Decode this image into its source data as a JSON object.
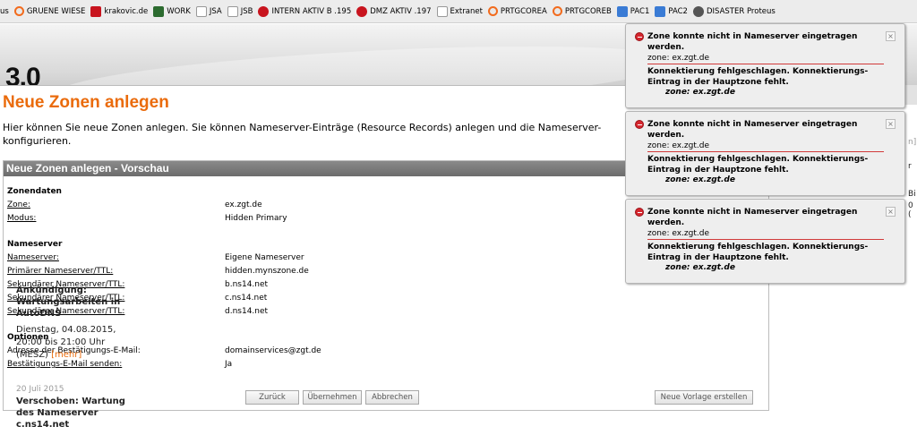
{
  "bookmarks": [
    {
      "label": "us",
      "icon": "page-icon"
    },
    {
      "label": "GRUENE WIESE",
      "icon": "prtg-icon"
    },
    {
      "label": "krakovic.de",
      "icon": "krakovic-icon"
    },
    {
      "label": "WORK",
      "icon": "work-icon"
    },
    {
      "label": "JSA",
      "icon": "blank-page-icon"
    },
    {
      "label": "JSB",
      "icon": "blank-page-icon"
    },
    {
      "label": "INTERN AKTIV B .195",
      "icon": "intern-icon"
    },
    {
      "label": "DMZ AKTIV .197",
      "icon": "dmz-icon"
    },
    {
      "label": "Extranet",
      "icon": "extranet-icon"
    },
    {
      "label": "PRTGCOREA",
      "icon": "prtg-icon"
    },
    {
      "label": "PRTGCOREB",
      "icon": "prtg-icon"
    },
    {
      "label": "PAC1",
      "icon": "pac-icon"
    },
    {
      "label": "PAC2",
      "icon": "pac-icon"
    },
    {
      "label": "DISASTER Proteus",
      "icon": "disaster-icon"
    }
  ],
  "header": {
    "logo": "3.0"
  },
  "page": {
    "title": "Neue Zonen anlegen",
    "intro": "Hier können Sie neue Zonen anlegen. Sie können Nameserver-Einträge (Resource Records) anlegen und die Nameserver-",
    "intro2": "konfigurieren."
  },
  "panel": {
    "title": "Neue Zonen anlegen - Vorschau",
    "zonendaten": {
      "heading": "Zonendaten",
      "zone_label": "Zone:",
      "zone_value": "ex.zgt.de",
      "modus_label": "Modus:",
      "modus_value": "Hidden Primary"
    },
    "nameserver": {
      "heading": "Nameserver",
      "ns_label": "Nameserver:",
      "ns_value": "Eigene Nameserver",
      "primary_label": "Primärer Nameserver/TTL:",
      "primary_value": "hidden.mynszone.de",
      "sec1_label": "Sekundärer Nameserver/TTL:",
      "sec1_value": "b.ns14.net",
      "sec2_label": "Sekundärer Nameserver/TTL:",
      "sec2_value": "c.ns14.net",
      "sec3_label": "Sekundärer Nameserver/TTL:",
      "sec3_value": "d.ns14.net"
    },
    "optionen": {
      "heading": "Optionen",
      "email_label": "Adresse der Bestätigungs-E-Mail:",
      "email_value": "domainservices@zgt.de",
      "send_label": "Bestätigungs-E-Mail senden:",
      "send_value": "Ja"
    },
    "buttons": {
      "back": "Zurück",
      "apply": "Übernehmen",
      "cancel": "Abbrechen",
      "template": "Neue Vorlage erstellen"
    }
  },
  "sidebar": {
    "peek1": "n]",
    "peek2": "r",
    "peek3": "Bi",
    "peek4": "0 (",
    "news1_title": "Ankündigung: Wartungsarbeiten in AutoDNS",
    "news1_body": "Dienstag, 04.08.2015, 20:00 bis 21:00 Uhr (MESZ)",
    "news1_more": "[mehr]",
    "news2_date": "20 Juli 2015",
    "news2_title": "Verschoben: Wartung des Nameserver c.ns14.net"
  },
  "notifications": [
    {
      "title": "Zone konnte nicht in Nameserver eingetragen werden.",
      "zone": "zone: ex.zgt.de",
      "message": "Konnektierung fehlgeschlagen. Konnektierungs-Eintrag in der Hauptzone fehlt.",
      "detail": "zone: ex.zgt.de",
      "close": "×"
    },
    {
      "title": "Zone konnte nicht in Nameserver eingetragen werden.",
      "zone": "zone: ex.zgt.de",
      "message": "Konnektierung fehlgeschlagen. Konnektierungs-Eintrag in der Hauptzone fehlt.",
      "detail": "zone: ex.zgt.de",
      "close": "×"
    },
    {
      "title": "Zone konnte nicht in Nameserver eingetragen werden.",
      "zone": "zone: ex.zgt.de",
      "message": "Konnektierung fehlgeschlagen. Konnektierungs-Eintrag in der Hauptzone fehlt.",
      "detail": "zone: ex.zgt.de",
      "close": "×"
    }
  ]
}
